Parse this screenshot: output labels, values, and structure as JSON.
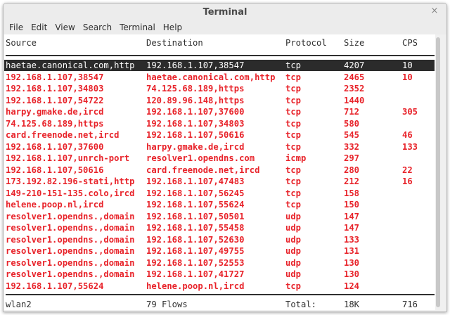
{
  "window": {
    "title": "Terminal",
    "close_glyph": "×"
  },
  "menu": [
    "File",
    "Edit",
    "View",
    "Search",
    "Terminal",
    "Help"
  ],
  "table": {
    "headers": [
      "Source",
      "Destination",
      "Protocol",
      "Size",
      "CPS"
    ],
    "rows": [
      [
        "haetae.canonical.com,http",
        "192.168.1.107,38547",
        "tcp",
        "4207",
        "10"
      ],
      [
        "192.168.1.107,38547",
        "haetae.canonical.com,http",
        "tcp",
        "2465",
        "10"
      ],
      [
        "192.168.1.107,34803",
        "74.125.68.189,https",
        "tcp",
        "2352",
        ""
      ],
      [
        "192.168.1.107,54722",
        "120.89.96.148,https",
        "tcp",
        "1440",
        ""
      ],
      [
        "harpy.gmake.de,ircd",
        "192.168.1.107,37600",
        "tcp",
        "712",
        "305"
      ],
      [
        "74.125.68.189,https",
        "192.168.1.107,34803",
        "tcp",
        "580",
        ""
      ],
      [
        "card.freenode.net,ircd",
        "192.168.1.107,50616",
        "tcp",
        "545",
        "46"
      ],
      [
        "192.168.1.107,37600",
        "harpy.gmake.de,ircd",
        "tcp",
        "332",
        "133"
      ],
      [
        "192.168.1.107,unrch-port",
        "resolver1.opendns.com",
        "icmp",
        "297",
        ""
      ],
      [
        "192.168.1.107,50616",
        "card.freenode.net,ircd",
        "tcp",
        "280",
        "22"
      ],
      [
        "173.192.82.196-stati,http",
        "192.168.1.107,47483",
        "tcp",
        "212",
        "16"
      ],
      [
        "149-210-151-135.colo,ircd",
        "192.168.1.107,56245",
        "tcp",
        "158",
        ""
      ],
      [
        "helene.poop.nl,ircd",
        "192.168.1.107,55624",
        "tcp",
        "150",
        ""
      ],
      [
        "resolver1.opendns.,domain",
        "192.168.1.107,50501",
        "udp",
        "147",
        ""
      ],
      [
        "resolver1.opendns.,domain",
        "192.168.1.107,55458",
        "udp",
        "147",
        ""
      ],
      [
        "resolver1.opendns.,domain",
        "192.168.1.107,52630",
        "udp",
        "133",
        ""
      ],
      [
        "resolver1.opendns.,domain",
        "192.168.1.107,49755",
        "udp",
        "131",
        ""
      ],
      [
        "resolver1.opendns.,domain",
        "192.168.1.107,52553",
        "udp",
        "130",
        ""
      ],
      [
        "resolver1.opendns.,domain",
        "192.168.1.107,41727",
        "udp",
        "130",
        ""
      ],
      [
        "192.168.1.107,55624",
        "helene.poop.nl,ircd",
        "tcp",
        "124",
        ""
      ]
    ],
    "selected_row": 0
  },
  "footer": {
    "interface": "wlan2",
    "flows": "79 Flows",
    "total_label": "Total:",
    "total_size": "18K",
    "total_cps": "716"
  },
  "colors": {
    "row_text": "#e8232a",
    "selected_bg": "#2b2b2b",
    "selected_text": "#ffffff"
  }
}
